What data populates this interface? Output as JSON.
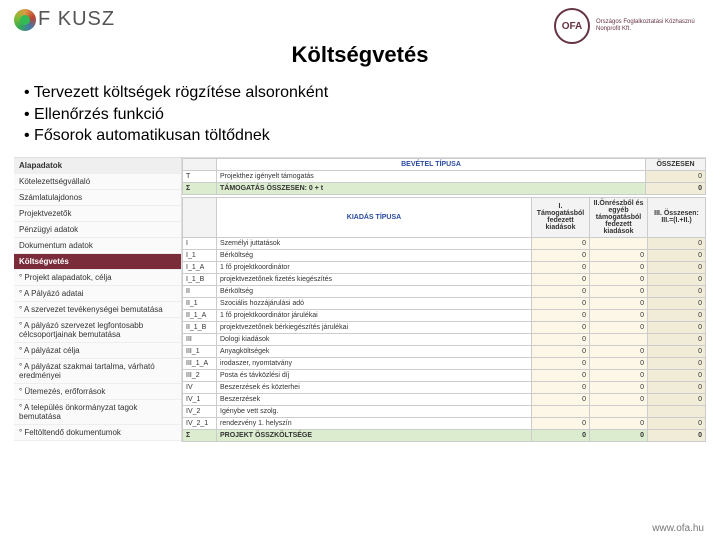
{
  "header": {
    "logo_left": "F   KUSZ",
    "logo_right_abbr": "OFA",
    "logo_right_text": "Országos Foglalkoztatási Közhasznú Nonprofit Kft."
  },
  "title": "Költségvetés",
  "bullets": [
    "Tervezett költségek rögzítése alsoronként",
    "Ellenőrzés funkció",
    "Fősorok automatikusan töltődnek"
  ],
  "sidebar": [
    {
      "label": "Alapadatok",
      "type": "hdr"
    },
    {
      "label": "Kötelezettségvállaló"
    },
    {
      "label": "Számlatulajdonos"
    },
    {
      "label": "Projektvezetők"
    },
    {
      "label": "Pénzügyi adatok"
    },
    {
      "label": "Dokumentum adatok"
    },
    {
      "label": "Költségvetés",
      "type": "active"
    },
    {
      "label": "° Projekt alapadatok, célja"
    },
    {
      "label": "° A Pályázó adatai"
    },
    {
      "label": "° A szervezet tevékenységei bemutatása"
    },
    {
      "label": "° A pályázó szervezet legfontosabb célcsoportjainak bemutatása"
    },
    {
      "label": "° A pályázat célja"
    },
    {
      "label": "° A pályázat szakmai tartalma, várható eredményei"
    },
    {
      "label": "° Ütemezés, erőforrások"
    },
    {
      "label": "° A település önkormányzat tagok bemutatása"
    },
    {
      "label": "° Feltöltendő dokumentumok"
    }
  ],
  "income": {
    "header_type": "BEVÉTEL TÍPUSA",
    "header_total": "ÖSSZESEN",
    "rows": [
      {
        "code": "T",
        "label": "Projekthez igényelt támogatás",
        "val": "0"
      },
      {
        "code": "Σ",
        "label": "TÁMOGATÁS ÖSSZESEN: 0 + t",
        "val": "0",
        "total": true
      }
    ]
  },
  "expense": {
    "header_type": "KIADÁS TÍPUSA",
    "header_c1": "I. Támogatásból fedezett kiadások",
    "header_c2": "II.Önrészből és egyéb támogatásból fedezett kiadások",
    "header_c3": "III. Összesen: III.=(I.+II.)",
    "rows": [
      {
        "code": "I",
        "label": "Személyi juttatások",
        "c1": "0",
        "c2": "",
        "c3": "0"
      },
      {
        "code": "I_1",
        "label": "Bérköltség",
        "c1": "0",
        "c2": "0",
        "c3": "0"
      },
      {
        "code": "I_1_A",
        "label": "1 fő projektkoordinátor",
        "c1": "0",
        "c2": "0",
        "c3": "0"
      },
      {
        "code": "I_1_B",
        "label": "projektvezetőnek fizetés kiegészítés",
        "c1": "0",
        "c2": "0",
        "c3": "0"
      },
      {
        "code": "II",
        "label": "Bérköltség",
        "c1": "0",
        "c2": "0",
        "c3": "0"
      },
      {
        "code": "II_1",
        "label": "Szociális hozzájárulási adó",
        "c1": "0",
        "c2": "0",
        "c3": "0"
      },
      {
        "code": "II_1_A",
        "label": "1 fő projektkoordinátor járulékai",
        "c1": "0",
        "c2": "0",
        "c3": "0"
      },
      {
        "code": "II_1_B",
        "label": "projektvezetőnek bérkiegészítés járulékai",
        "c1": "0",
        "c2": "0",
        "c3": "0"
      },
      {
        "code": "III",
        "label": "Dologi kiadások",
        "c1": "0",
        "c2": "",
        "c3": "0"
      },
      {
        "code": "III_1",
        "label": "Anyagköltségek",
        "c1": "0",
        "c2": "0",
        "c3": "0"
      },
      {
        "code": "III_1_A",
        "label": "irodaszer, nyomtatvány",
        "c1": "0",
        "c2": "0",
        "c3": "0"
      },
      {
        "code": "III_2",
        "label": "Posta és távközlési díj",
        "c1": "0",
        "c2": "0",
        "c3": "0"
      },
      {
        "code": "IV",
        "label": "Beszerzések és közterhei",
        "c1": "0",
        "c2": "0",
        "c3": "0"
      },
      {
        "code": "IV_1",
        "label": "Beszerzések",
        "c1": "0",
        "c2": "0",
        "c3": "0"
      },
      {
        "code": "IV_2",
        "label": "Igénybe vett szolg.",
        "c1": "",
        "c2": "",
        "c3": ""
      },
      {
        "code": "IV_2_1",
        "label": "rendezvény 1. helyszín",
        "c1": "0",
        "c2": "0",
        "c3": "0"
      },
      {
        "code": "Σ",
        "label": "PROJEKT ÖSSZKÖLTSÉGE",
        "c1": "0",
        "c2": "0",
        "c3": "0",
        "total": true
      }
    ]
  },
  "footer_url": "www.ofa.hu"
}
